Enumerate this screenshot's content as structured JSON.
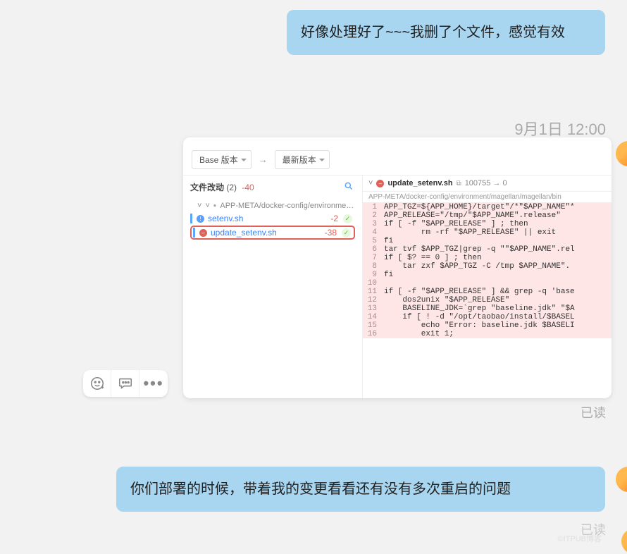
{
  "chat": {
    "msg1": "好像处理好了~~~我删了个文件，感觉有效",
    "timestamp": "9月1日 12:00",
    "msg2": "你们部署的时候，带着我的变更看看还有没有多次重启的问题",
    "status1": "已读",
    "status2": "已读",
    "watermark": "©ITPUB博客"
  },
  "actions": {
    "emoji": "😊",
    "chatdots": "💬",
    "more": "⋯"
  },
  "diff": {
    "dropdown_base": "Base 版本",
    "dropdown_latest": "最新版本",
    "files_label": "文件改动",
    "files_count": "(2)",
    "diff_total": "-40",
    "tree_path": "APP-META/docker-config/environment/m",
    "file1": {
      "name": "setenv.sh",
      "delta": "-2"
    },
    "file2": {
      "name": "update_setenv.sh",
      "delta": "-38"
    },
    "viewer": {
      "filename": "update_setenv.sh",
      "mode": "100755 → 0",
      "full_path": "APP-META/docker-config/environment/magellan/magellan/bin",
      "lines": [
        "APP_TGZ=${APP_HOME}/target\"/*\"$APP_NAME\"*",
        "APP_RELEASE=\"/tmp/\"$APP_NAME\".release\"",
        "if [ -f \"$APP_RELEASE\" ] ; then",
        "        rm -rf \"$APP_RELEASE\" || exit",
        "fi",
        "tar tvf $APP_TGZ|grep -q \"\"$APP_NAME\".rel",
        "if [ $? == 0 ] ; then",
        "    tar zxf $APP_TGZ -C /tmp $APP_NAME\".",
        "fi",
        "",
        "if [ -f \"$APP_RELEASE\" ] && grep -q 'base",
        "    dos2unix \"$APP_RELEASE\"",
        "    BASELINE_JDK=`grep \"baseline.jdk\" \"$A",
        "    if [ ! -d \"/opt/taobao/install/$BASEL",
        "        echo \"Error: baseline.jdk $BASELI",
        "        exit 1;"
      ]
    }
  }
}
